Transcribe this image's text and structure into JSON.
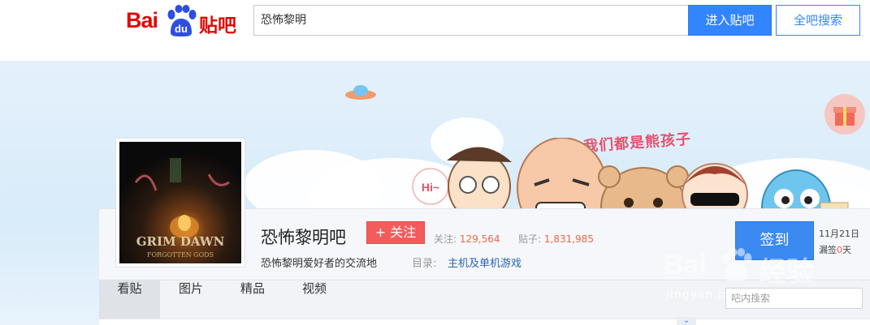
{
  "header": {
    "logo_text": "Bai",
    "logo_du": "du",
    "logo_tieba": "贴吧",
    "search_value": "恐怖黎明",
    "enter_button": "进入贴吧",
    "search_all_button": "全吧搜索"
  },
  "banner": {
    "slogan": "我们都是熊孩子",
    "hi_bubble": "Hi~"
  },
  "forum": {
    "name": "恐怖黎明吧",
    "follow_button": "+ 关注",
    "follow_label": "关注:",
    "follow_count": "129,564",
    "posts_label": "贴子:",
    "posts_count": "1,831,985",
    "slogan": "恐怖黎明爱好者的交流地",
    "directory_label": "目录:",
    "directory_value": "主机及单机游戏",
    "avatar_title": "GRIM DAWN",
    "avatar_subtitle": "FORGOTTEN GODS"
  },
  "signin": {
    "button": "签到",
    "date": "11月21日",
    "missed_label": "漏签",
    "missed_count": "0",
    "missed_unit": "天"
  },
  "tabs": [
    {
      "label": "看贴",
      "active": true
    },
    {
      "label": "图片",
      "active": false
    },
    {
      "label": "精品",
      "active": false
    },
    {
      "label": "视频",
      "active": false
    }
  ],
  "inbar_search": {
    "placeholder": "吧内搜索"
  },
  "watermark": {
    "brand": "Bai",
    "brand_suffix": "经验",
    "url": "jingyan.baidu.com"
  },
  "colors": {
    "brand_red": "#e10602",
    "primary_blue": "#3385ff",
    "follow_red": "#f45c5c",
    "stat_orange": "#f4634a",
    "link_blue": "#2d64b3"
  },
  "icons": [
    "baidu-paw-icon",
    "gift-icon",
    "ufo-icon",
    "chevron-down-icon"
  ]
}
